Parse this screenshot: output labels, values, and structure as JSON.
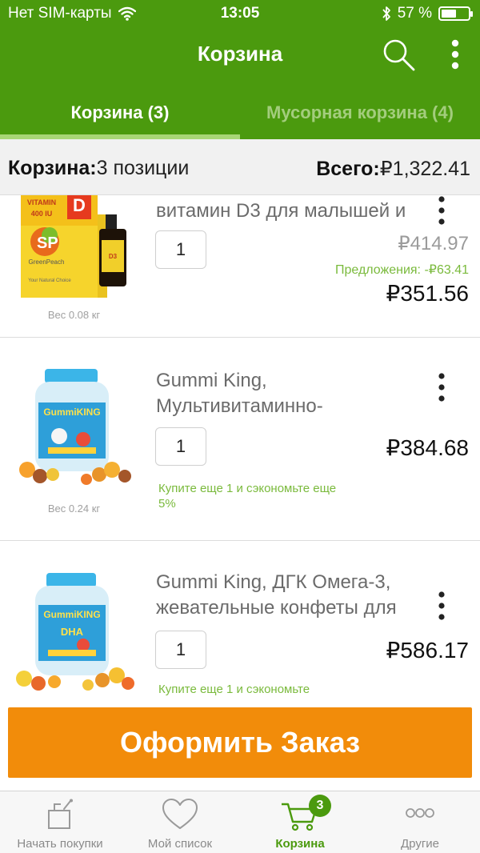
{
  "status_bar": {
    "carrier": "Нет SIM-карты",
    "time": "13:05",
    "battery": "57 %",
    "battery_level": 0.57
  },
  "nav": {
    "title": "Корзина",
    "search_icon": "search-icon",
    "more_icon": "more-vertical-icon"
  },
  "tabs": [
    {
      "label": "Корзина (3)",
      "active": true
    },
    {
      "label": "Мусорная корзина (4)",
      "active": false
    }
  ],
  "summary": {
    "cart_label": "Корзина:",
    "cart_value": "3 позиции",
    "total_label": "Всего:",
    "total_value": "₽1,322.41"
  },
  "items": [
    {
      "title": "витамин D3 для малышей и",
      "quantity": "1",
      "price_old": "₽414.97",
      "discount": "Предложения: -₽63.41",
      "price": "₽351.56",
      "weight": "Вес 0.08 кг",
      "image": "vitamin-d3-box-image"
    },
    {
      "title": "Gummi King, Мультивитаминно-",
      "quantity": "1",
      "price": "₽384.68",
      "promo": "Купите еще 1 и сэкономьте еще 5%",
      "weight": "Вес 0.24 кг",
      "image": "gummi-king-multivitamin-image"
    },
    {
      "title": "Gummi King, ДГК Омега-3, жевательные конфеты для",
      "quantity": "1",
      "price": "₽586.17",
      "promo": "Купите еще 1 и сэкономьте",
      "image": "gummi-king-dha-image"
    }
  ],
  "checkout": {
    "label": "Оформить Заказ",
    "color": "#f28c0a"
  },
  "tabbar": [
    {
      "label": "Начать покупки",
      "icon": "shopping-bag-icon",
      "active": false
    },
    {
      "label": "Мой список",
      "icon": "heart-icon",
      "active": false
    },
    {
      "label": "Корзина",
      "icon": "cart-icon",
      "active": true,
      "badge": "3"
    },
    {
      "label": "Другие",
      "icon": "more-horizontal-icon",
      "active": false
    }
  ],
  "colors": {
    "brand_green": "#4b9a0e",
    "promo_green": "#7aba3c",
    "checkout_orange": "#f28c0a"
  }
}
